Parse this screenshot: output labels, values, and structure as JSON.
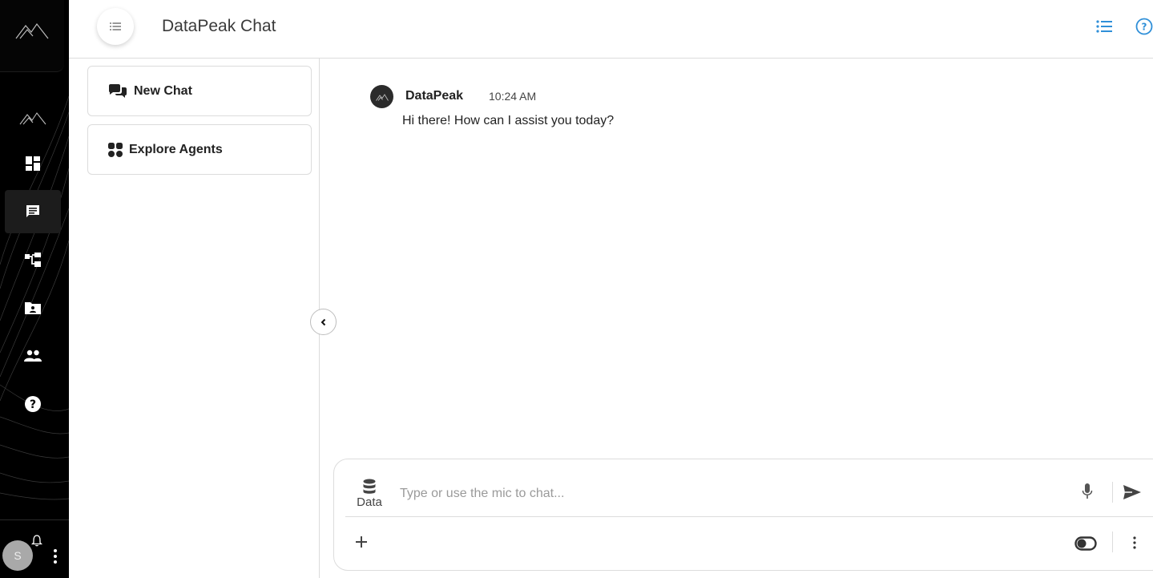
{
  "header": {
    "title": "DataPeak Chat"
  },
  "rail": {
    "avatar_initial": "S",
    "items": [
      {
        "icon": "mountain-icon"
      },
      {
        "icon": "dashboard-icon"
      },
      {
        "icon": "chat-icon"
      },
      {
        "icon": "workflow-icon"
      },
      {
        "icon": "folder-icon"
      },
      {
        "icon": "users-icon"
      },
      {
        "icon": "help-icon"
      }
    ]
  },
  "side": {
    "new_chat_label": "New Chat",
    "explore_agents_label": "Explore Agents"
  },
  "chat": {
    "messages": [
      {
        "sender": "DataPeak",
        "time": "10:24 AM",
        "text": "Hi there! How can I assist you today?"
      }
    ]
  },
  "composer": {
    "data_label": "Data",
    "placeholder": "Type or use the mic to chat...",
    "value": ""
  },
  "colors": {
    "accent": "#2f8fd8",
    "rail_bg": "#000000",
    "border": "#dcdcdc"
  }
}
